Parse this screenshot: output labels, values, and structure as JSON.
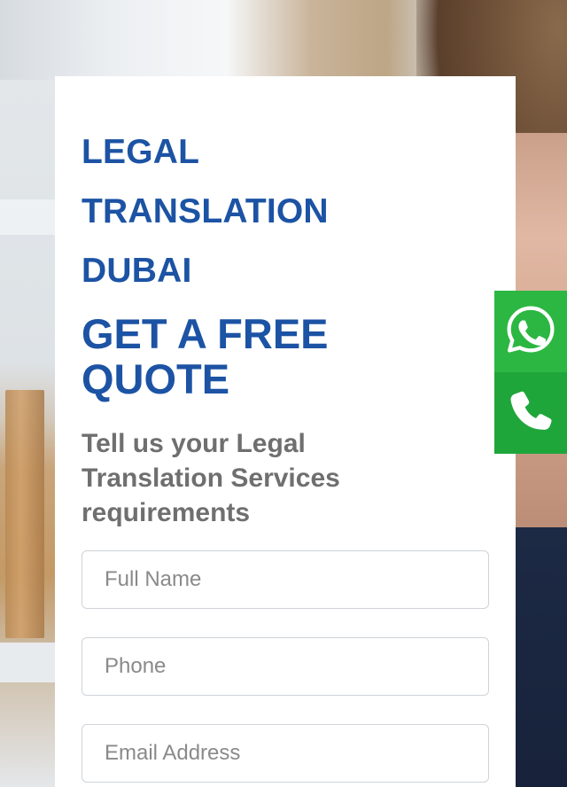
{
  "brand": {
    "title_lines": [
      "LEGAL",
      "TRANSLATION",
      "DUBAI"
    ],
    "color": "#1c53a4"
  },
  "form": {
    "heading": "GET A FREE QUOTE",
    "subheading": "Tell us your Legal Translation Services requirements",
    "fields": {
      "full_name": {
        "placeholder": "Full Name",
        "value": ""
      },
      "phone": {
        "placeholder": "Phone",
        "value": ""
      },
      "email": {
        "placeholder": "Email Address",
        "value": ""
      }
    }
  },
  "floating_buttons": {
    "whatsapp": {
      "icon": "whatsapp-icon",
      "color": "#2cb742"
    },
    "call": {
      "icon": "phone-icon",
      "color": "#1fa63a"
    }
  }
}
